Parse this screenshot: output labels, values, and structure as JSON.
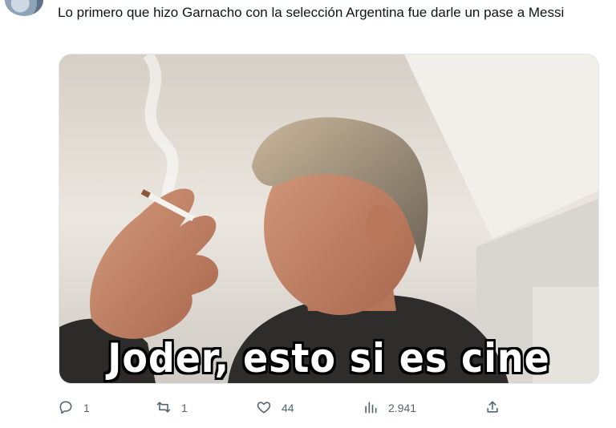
{
  "tweet": {
    "text": "Lo primero que hizo Garnacho con la selección Argentina fue darle un pase a Messi",
    "media": {
      "caption": "Joder, esto si es cine"
    }
  },
  "actions": {
    "reply": {
      "icon": "reply-icon",
      "count": "1"
    },
    "retweet": {
      "icon": "retweet-icon",
      "count": "1"
    },
    "like": {
      "icon": "heart-icon",
      "count": "44"
    },
    "views": {
      "icon": "views-icon",
      "count": "2.941"
    },
    "share": {
      "icon": "share-icon"
    }
  },
  "colors": {
    "text": "#0f1419",
    "secondary": "#536471"
  }
}
